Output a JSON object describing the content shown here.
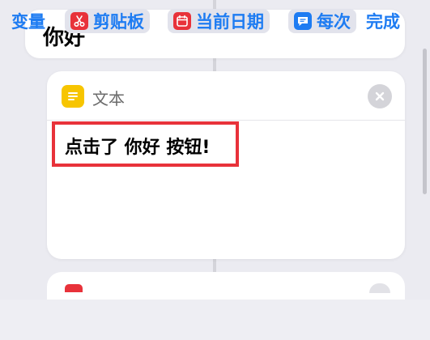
{
  "top_card": {
    "title": "你好"
  },
  "text_action": {
    "header_label": "文本",
    "content": "点击了 你好 按钮!",
    "icon": "text-doc-icon",
    "accent_color": "#f7c500"
  },
  "highlight_color": "#e8323a",
  "toolbar": {
    "variables_label": "变量",
    "clipboard_label": "剪贴板",
    "current_date_label": "当前日期",
    "every_label": "每次",
    "done_label": "完成",
    "accent_color": "#1e7cf2"
  }
}
